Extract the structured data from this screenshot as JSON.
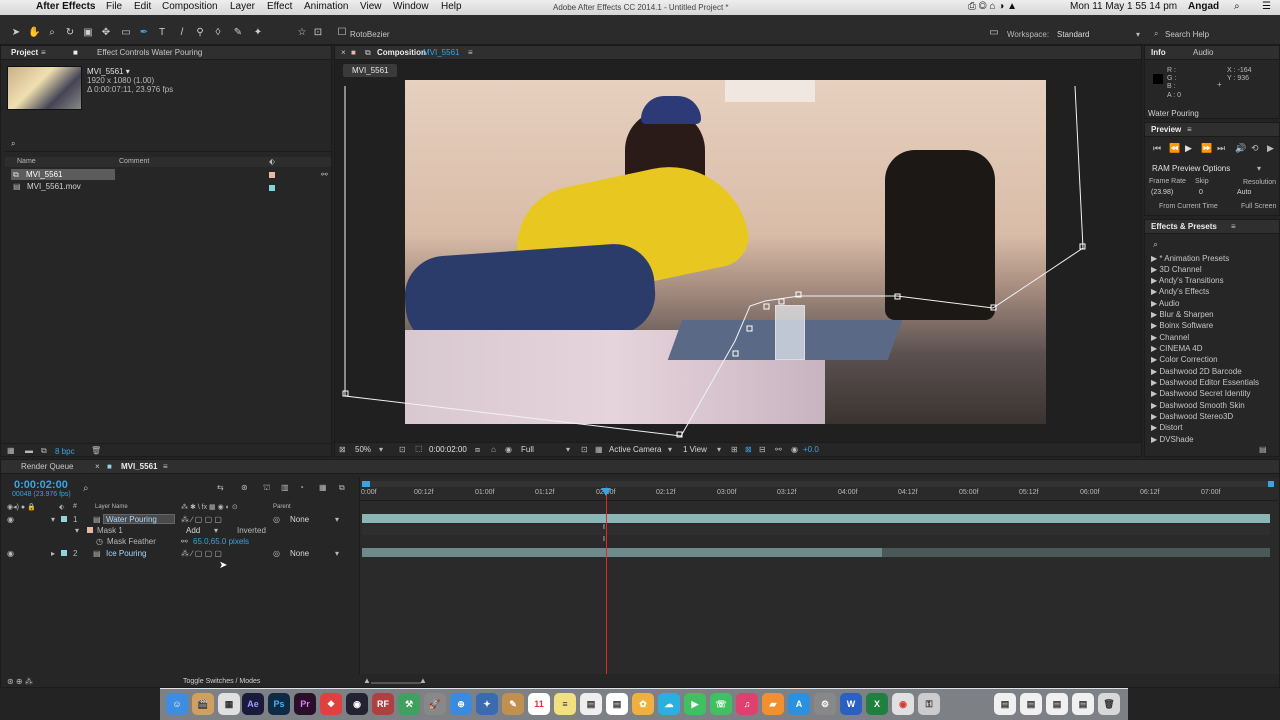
{
  "menubar": {
    "apple": "",
    "app_name": "After Effects",
    "items": [
      "File",
      "Edit",
      "Composition",
      "Layer",
      "Effect",
      "Animation",
      "View",
      "Window",
      "Help"
    ],
    "window_title": "Adobe After Effects CC 2014.1 - Untitled Project *",
    "clock": "Mon 11 May  1 55 14 pm",
    "user": "Angad"
  },
  "toolbar": {
    "rotobezier_label": "RotoBezier",
    "workspace_label": "Workspace:",
    "workspace_value": "Standard",
    "search_help": "Search Help"
  },
  "project": {
    "tab_project": "Project",
    "tab_effect_controls": "Effect Controls Water Pouring",
    "item_name": "MVI_5561 ▾",
    "item_res": "1920 x 1080 (1.00)",
    "item_dur": "Δ 0:00:07:11, 23.976 fps",
    "col_name": "Name",
    "col_comment": "Comment",
    "files": [
      "MVI_5561",
      "MVI_5561.mov"
    ],
    "bpc": "8 bpc"
  },
  "composition": {
    "tab_label": "Composition",
    "tab_comp_name": "MVI_5561",
    "sub_tab": "MVI_5561",
    "zoom": "50%",
    "timecode": "0:00:02:00",
    "resolution": "Full",
    "camera": "Active Camera",
    "view": "1 View",
    "exposure": "+0.0"
  },
  "info": {
    "tab_info": "Info",
    "tab_audio": "Audio",
    "r": "R :",
    "g": "G :",
    "b": "B :",
    "a": "A : 0",
    "x": "X : -164",
    "y": "Y : 936",
    "layer_name": "Water Pouring"
  },
  "preview": {
    "title": "Preview",
    "ram_options": "RAM Preview Options",
    "frame_rate_label": "Frame Rate",
    "skip_label": "Skip",
    "resolution_label": "Resolution",
    "frame_rate_value": "(23.98)",
    "skip_value": "0",
    "resolution_value": "Auto",
    "from_current": "From Current Time",
    "full_screen": "Full Screen"
  },
  "effects": {
    "title": "Effects & Presets",
    "items": [
      "▶ * Animation Presets",
      "▶ 3D Channel",
      "▶ Andy's Transitions",
      "▶ Andy's Effects",
      "▶ Audio",
      "▶ Blur & Sharpen",
      "▶ Boinx Software",
      "▶ Channel",
      "▶ CINEMA 4D",
      "▶ Color Correction",
      "▶ Dashwood 2D Barcode",
      "▶ Dashwood Editor Essentials",
      "▶ Dashwood Secret Identity",
      "▶ Dashwood Smooth Skin",
      "▶ Dashwood Stereo3D",
      "▶ Distort",
      "▶ DVShade"
    ]
  },
  "timeline": {
    "tab_render": "Render Queue",
    "tab_comp": "MVI_5561",
    "timecode": "0:00:02:00",
    "frames": "00048 (23.976 fps)",
    "col_layer_name": "Layer Name",
    "col_parent": "Parent",
    "layers": [
      {
        "num": "1",
        "name": "Water Pouring",
        "parent": "None"
      },
      {
        "num": "2",
        "name": "Ice Pouring",
        "parent": "None"
      }
    ],
    "mask_name": "Mask 1",
    "mask_mode": "Add",
    "mask_inverted": "Inverted",
    "mask_feather_label": "Mask Feather",
    "mask_feather_value": "65.0,65.0 pixels",
    "toggle_label": "Toggle Switches / Modes",
    "ruler": [
      "0:00f",
      "00:12f",
      "01:00f",
      "01:12f",
      "02:00f",
      "02:12f",
      "03:00f",
      "03:12f",
      "04:00f",
      "04:12f",
      "05:00f",
      "05:12f",
      "06:00f",
      "06:12f",
      "07:00f"
    ]
  },
  "dock": {
    "icons": [
      "Finder",
      "Claquette",
      "Ae",
      "Ps",
      "Pr",
      "DaVinci",
      "Safari",
      "Pages",
      "Calendar",
      "Photos",
      "iTunes",
      "App Store"
    ]
  },
  "colors": {
    "accent_blue": "#3aa3e3",
    "playhead_red": "#e02a2a",
    "layer_bar_teal": "#8ab6b6"
  }
}
